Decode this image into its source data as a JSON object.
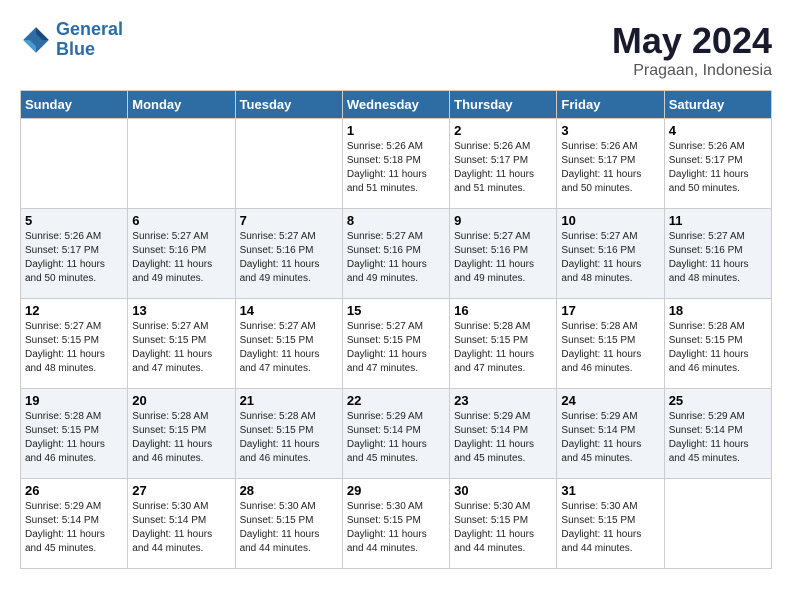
{
  "header": {
    "logo_line1": "General",
    "logo_line2": "Blue",
    "month": "May 2024",
    "location": "Pragaan, Indonesia"
  },
  "weekdays": [
    "Sunday",
    "Monday",
    "Tuesday",
    "Wednesday",
    "Thursday",
    "Friday",
    "Saturday"
  ],
  "weeks": [
    [
      {
        "day": "",
        "sunrise": "",
        "sunset": "",
        "daylight": ""
      },
      {
        "day": "",
        "sunrise": "",
        "sunset": "",
        "daylight": ""
      },
      {
        "day": "",
        "sunrise": "",
        "sunset": "",
        "daylight": ""
      },
      {
        "day": "1",
        "sunrise": "Sunrise: 5:26 AM",
        "sunset": "Sunset: 5:18 PM",
        "daylight": "Daylight: 11 hours and 51 minutes."
      },
      {
        "day": "2",
        "sunrise": "Sunrise: 5:26 AM",
        "sunset": "Sunset: 5:17 PM",
        "daylight": "Daylight: 11 hours and 51 minutes."
      },
      {
        "day": "3",
        "sunrise": "Sunrise: 5:26 AM",
        "sunset": "Sunset: 5:17 PM",
        "daylight": "Daylight: 11 hours and 50 minutes."
      },
      {
        "day": "4",
        "sunrise": "Sunrise: 5:26 AM",
        "sunset": "Sunset: 5:17 PM",
        "daylight": "Daylight: 11 hours and 50 minutes."
      }
    ],
    [
      {
        "day": "5",
        "sunrise": "Sunrise: 5:26 AM",
        "sunset": "Sunset: 5:17 PM",
        "daylight": "Daylight: 11 hours and 50 minutes."
      },
      {
        "day": "6",
        "sunrise": "Sunrise: 5:27 AM",
        "sunset": "Sunset: 5:16 PM",
        "daylight": "Daylight: 11 hours and 49 minutes."
      },
      {
        "day": "7",
        "sunrise": "Sunrise: 5:27 AM",
        "sunset": "Sunset: 5:16 PM",
        "daylight": "Daylight: 11 hours and 49 minutes."
      },
      {
        "day": "8",
        "sunrise": "Sunrise: 5:27 AM",
        "sunset": "Sunset: 5:16 PM",
        "daylight": "Daylight: 11 hours and 49 minutes."
      },
      {
        "day": "9",
        "sunrise": "Sunrise: 5:27 AM",
        "sunset": "Sunset: 5:16 PM",
        "daylight": "Daylight: 11 hours and 49 minutes."
      },
      {
        "day": "10",
        "sunrise": "Sunrise: 5:27 AM",
        "sunset": "Sunset: 5:16 PM",
        "daylight": "Daylight: 11 hours and 48 minutes."
      },
      {
        "day": "11",
        "sunrise": "Sunrise: 5:27 AM",
        "sunset": "Sunset: 5:16 PM",
        "daylight": "Daylight: 11 hours and 48 minutes."
      }
    ],
    [
      {
        "day": "12",
        "sunrise": "Sunrise: 5:27 AM",
        "sunset": "Sunset: 5:15 PM",
        "daylight": "Daylight: 11 hours and 48 minutes."
      },
      {
        "day": "13",
        "sunrise": "Sunrise: 5:27 AM",
        "sunset": "Sunset: 5:15 PM",
        "daylight": "Daylight: 11 hours and 47 minutes."
      },
      {
        "day": "14",
        "sunrise": "Sunrise: 5:27 AM",
        "sunset": "Sunset: 5:15 PM",
        "daylight": "Daylight: 11 hours and 47 minutes."
      },
      {
        "day": "15",
        "sunrise": "Sunrise: 5:27 AM",
        "sunset": "Sunset: 5:15 PM",
        "daylight": "Daylight: 11 hours and 47 minutes."
      },
      {
        "day": "16",
        "sunrise": "Sunrise: 5:28 AM",
        "sunset": "Sunset: 5:15 PM",
        "daylight": "Daylight: 11 hours and 47 minutes."
      },
      {
        "day": "17",
        "sunrise": "Sunrise: 5:28 AM",
        "sunset": "Sunset: 5:15 PM",
        "daylight": "Daylight: 11 hours and 46 minutes."
      },
      {
        "day": "18",
        "sunrise": "Sunrise: 5:28 AM",
        "sunset": "Sunset: 5:15 PM",
        "daylight": "Daylight: 11 hours and 46 minutes."
      }
    ],
    [
      {
        "day": "19",
        "sunrise": "Sunrise: 5:28 AM",
        "sunset": "Sunset: 5:15 PM",
        "daylight": "Daylight: 11 hours and 46 minutes."
      },
      {
        "day": "20",
        "sunrise": "Sunrise: 5:28 AM",
        "sunset": "Sunset: 5:15 PM",
        "daylight": "Daylight: 11 hours and 46 minutes."
      },
      {
        "day": "21",
        "sunrise": "Sunrise: 5:28 AM",
        "sunset": "Sunset: 5:15 PM",
        "daylight": "Daylight: 11 hours and 46 minutes."
      },
      {
        "day": "22",
        "sunrise": "Sunrise: 5:29 AM",
        "sunset": "Sunset: 5:14 PM",
        "daylight": "Daylight: 11 hours and 45 minutes."
      },
      {
        "day": "23",
        "sunrise": "Sunrise: 5:29 AM",
        "sunset": "Sunset: 5:14 PM",
        "daylight": "Daylight: 11 hours and 45 minutes."
      },
      {
        "day": "24",
        "sunrise": "Sunrise: 5:29 AM",
        "sunset": "Sunset: 5:14 PM",
        "daylight": "Daylight: 11 hours and 45 minutes."
      },
      {
        "day": "25",
        "sunrise": "Sunrise: 5:29 AM",
        "sunset": "Sunset: 5:14 PM",
        "daylight": "Daylight: 11 hours and 45 minutes."
      }
    ],
    [
      {
        "day": "26",
        "sunrise": "Sunrise: 5:29 AM",
        "sunset": "Sunset: 5:14 PM",
        "daylight": "Daylight: 11 hours and 45 minutes."
      },
      {
        "day": "27",
        "sunrise": "Sunrise: 5:30 AM",
        "sunset": "Sunset: 5:14 PM",
        "daylight": "Daylight: 11 hours and 44 minutes."
      },
      {
        "day": "28",
        "sunrise": "Sunrise: 5:30 AM",
        "sunset": "Sunset: 5:15 PM",
        "daylight": "Daylight: 11 hours and 44 minutes."
      },
      {
        "day": "29",
        "sunrise": "Sunrise: 5:30 AM",
        "sunset": "Sunset: 5:15 PM",
        "daylight": "Daylight: 11 hours and 44 minutes."
      },
      {
        "day": "30",
        "sunrise": "Sunrise: 5:30 AM",
        "sunset": "Sunset: 5:15 PM",
        "daylight": "Daylight: 11 hours and 44 minutes."
      },
      {
        "day": "31",
        "sunrise": "Sunrise: 5:30 AM",
        "sunset": "Sunset: 5:15 PM",
        "daylight": "Daylight: 11 hours and 44 minutes."
      },
      {
        "day": "",
        "sunrise": "",
        "sunset": "",
        "daylight": ""
      }
    ]
  ]
}
